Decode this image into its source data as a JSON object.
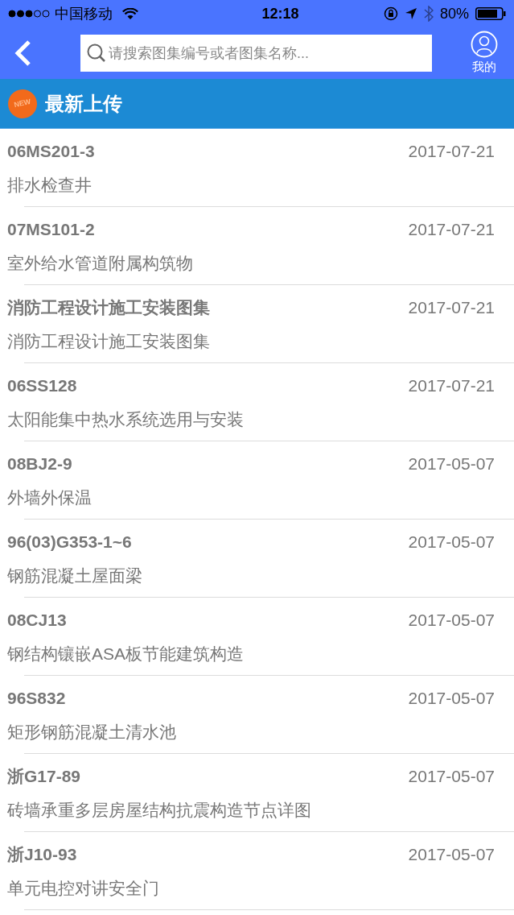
{
  "status_bar": {
    "carrier": "中国移动",
    "time": "12:18",
    "battery": "80%"
  },
  "nav": {
    "search": {
      "placeholder": "请搜索图集编号或者图集名称..."
    },
    "profile_label": "我的"
  },
  "section": {
    "badge": "NEW",
    "title": "最新上传"
  },
  "items": [
    {
      "code": "06MS201-3",
      "name": "排水检查井",
      "date": "2017-07-21"
    },
    {
      "code": "07MS101-2",
      "name": "室外给水管道附属构筑物",
      "date": "2017-07-21"
    },
    {
      "code": "消防工程设计施工安装图集",
      "name": "消防工程设计施工安装图集",
      "date": "2017-07-21"
    },
    {
      "code": "06SS128",
      "name": "太阳能集中热水系统选用与安装",
      "date": "2017-07-21"
    },
    {
      "code": "08BJ2-9",
      "name": "外墙外保温",
      "date": "2017-05-07"
    },
    {
      "code": "96(03)G353-1~6",
      "name": "钢筋混凝土屋面梁",
      "date": "2017-05-07"
    },
    {
      "code": "08CJ13",
      "name": "钢结构镶嵌ASA板节能建筑构造",
      "date": "2017-05-07"
    },
    {
      "code": "96S832",
      "name": "矩形钢筋混凝土清水池",
      "date": "2017-05-07"
    },
    {
      "code": "浙G17-89",
      "name": "砖墙承重多层房屋结构抗震构造节点详图",
      "date": "2017-05-07"
    },
    {
      "code": "浙J10-93",
      "name": "单元电控对讲安全门",
      "date": "2017-05-07"
    }
  ]
}
